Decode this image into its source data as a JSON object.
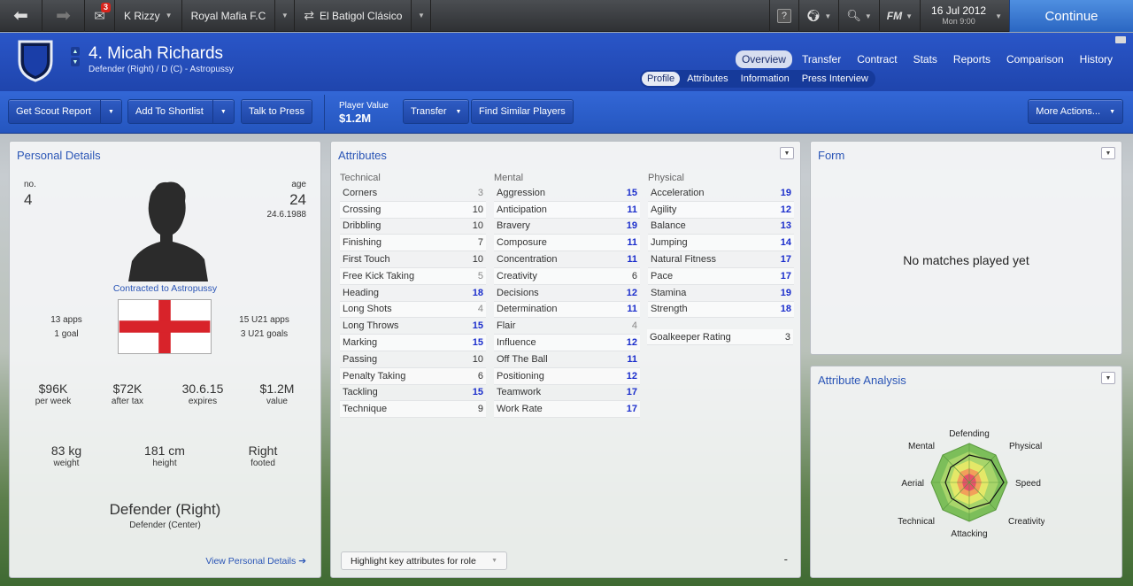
{
  "topbar": {
    "inbox_count": "3",
    "manager": "K Rizzy",
    "club": "Royal Mafia F.C",
    "fixture": "El Batigol Clásico",
    "help_label": "?",
    "fm_label": "FM",
    "date": "16 Jul 2012",
    "time": "Mon 9:00",
    "continue_label": "Continue"
  },
  "header": {
    "player_name": "4. Micah Richards",
    "player_position": "Defender (Right) / D (C) - Astropussy",
    "main_tabs": [
      "Overview",
      "Transfer",
      "Contract",
      "Stats",
      "Reports",
      "Comparison",
      "History"
    ],
    "sub_tabs": [
      "Profile",
      "Attributes",
      "Information",
      "Press Interview"
    ]
  },
  "toolbar": {
    "scout_report": "Get Scout Report",
    "add_shortlist": "Add To Shortlist",
    "talk_press": "Talk to Press",
    "player_value_label": "Player Value",
    "player_value": "$1.2M",
    "transfer": "Transfer",
    "find_similar": "Find Similar Players",
    "more_actions": "More Actions..."
  },
  "personal": {
    "title": "Personal Details",
    "no_label": "no.",
    "no": "4",
    "age_label": "age",
    "age": "24",
    "dob": "24.6.1988",
    "contract": "Contracted to Astropussy",
    "apps": "13 apps",
    "goals": "1 goal",
    "u21_apps": "15 U21 apps",
    "u21_goals": "3 U21 goals",
    "wage": "$96K",
    "wage_label": "per week",
    "after_tax": "$72K",
    "after_tax_label": "after tax",
    "expires": "30.6.15",
    "expires_label": "expires",
    "value": "$1.2M",
    "value_label": "value",
    "weight": "83 kg",
    "weight_label": "weight",
    "height": "181 cm",
    "height_label": "height",
    "foot": "Right",
    "foot_label": "footed",
    "role": "Defender (Right)",
    "role2": "Defender (Center)",
    "link": "View Personal Details"
  },
  "attributes": {
    "title": "Attributes",
    "technical_label": "Technical",
    "mental_label": "Mental",
    "physical_label": "Physical",
    "technical": [
      {
        "name": "Corners",
        "value": "3",
        "tier": "low"
      },
      {
        "name": "Crossing",
        "value": "10",
        "tier": "mid"
      },
      {
        "name": "Dribbling",
        "value": "10",
        "tier": "mid"
      },
      {
        "name": "Finishing",
        "value": "7",
        "tier": "mid"
      },
      {
        "name": "First Touch",
        "value": "10",
        "tier": "mid"
      },
      {
        "name": "Free Kick Taking",
        "value": "5",
        "tier": "low"
      },
      {
        "name": "Heading",
        "value": "18",
        "tier": "good"
      },
      {
        "name": "Long Shots",
        "value": "4",
        "tier": "low"
      },
      {
        "name": "Long Throws",
        "value": "15",
        "tier": "good"
      },
      {
        "name": "Marking",
        "value": "15",
        "tier": "good"
      },
      {
        "name": "Passing",
        "value": "10",
        "tier": "mid"
      },
      {
        "name": "Penalty Taking",
        "value": "6",
        "tier": "mid"
      },
      {
        "name": "Tackling",
        "value": "15",
        "tier": "good"
      },
      {
        "name": "Technique",
        "value": "9",
        "tier": "mid"
      }
    ],
    "mental": [
      {
        "name": "Aggression",
        "value": "15",
        "tier": "good"
      },
      {
        "name": "Anticipation",
        "value": "11",
        "tier": "good"
      },
      {
        "name": "Bravery",
        "value": "19",
        "tier": "good"
      },
      {
        "name": "Composure",
        "value": "11",
        "tier": "good"
      },
      {
        "name": "Concentration",
        "value": "11",
        "tier": "good"
      },
      {
        "name": "Creativity",
        "value": "6",
        "tier": "mid"
      },
      {
        "name": "Decisions",
        "value": "12",
        "tier": "good"
      },
      {
        "name": "Determination",
        "value": "11",
        "tier": "good"
      },
      {
        "name": "Flair",
        "value": "4",
        "tier": "low"
      },
      {
        "name": "Influence",
        "value": "12",
        "tier": "good"
      },
      {
        "name": "Off The Ball",
        "value": "11",
        "tier": "good"
      },
      {
        "name": "Positioning",
        "value": "12",
        "tier": "good"
      },
      {
        "name": "Teamwork",
        "value": "17",
        "tier": "good"
      },
      {
        "name": "Work Rate",
        "value": "17",
        "tier": "good"
      }
    ],
    "physical": [
      {
        "name": "Acceleration",
        "value": "19",
        "tier": "good"
      },
      {
        "name": "Agility",
        "value": "12",
        "tier": "good"
      },
      {
        "name": "Balance",
        "value": "13",
        "tier": "good"
      },
      {
        "name": "Jumping",
        "value": "14",
        "tier": "good"
      },
      {
        "name": "Natural Fitness",
        "value": "17",
        "tier": "good"
      },
      {
        "name": "Pace",
        "value": "17",
        "tier": "good"
      },
      {
        "name": "Stamina",
        "value": "19",
        "tier": "good"
      },
      {
        "name": "Strength",
        "value": "18",
        "tier": "good"
      }
    ],
    "gk_label": "Goalkeeper Rating",
    "gk_value": "3",
    "highlight_label": "Highlight key attributes for role",
    "dash": "-"
  },
  "form": {
    "title": "Form",
    "message": "No matches played yet"
  },
  "analysis": {
    "title": "Attribute Analysis",
    "labels": {
      "defending": "Defending",
      "physical": "Physical",
      "speed": "Speed",
      "creativity": "Creativity",
      "attacking": "Attacking",
      "technical": "Technical",
      "aerial": "Aerial",
      "mental": "Mental"
    }
  },
  "colors": {
    "accent": "#2a55b6",
    "good_value": "#1a2dcc",
    "continue": "#3a7ad6"
  }
}
